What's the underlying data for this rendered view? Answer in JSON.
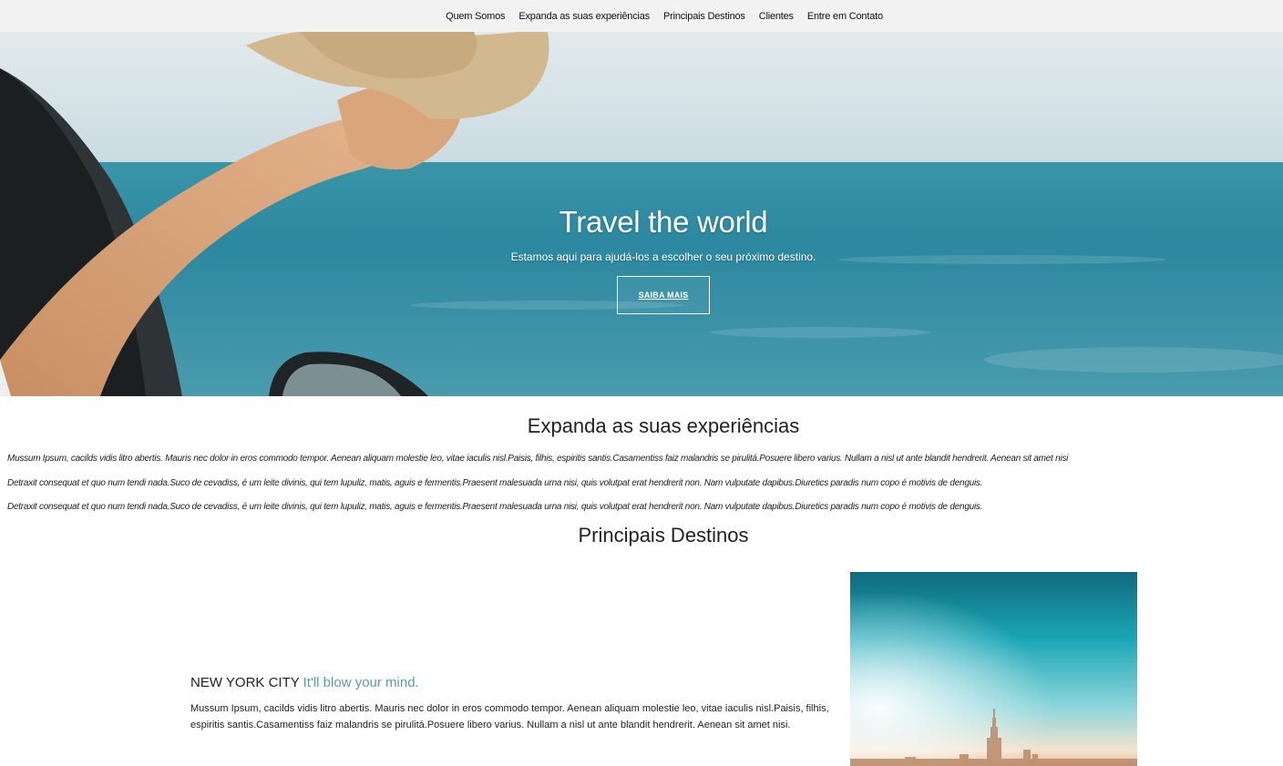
{
  "nav": {
    "items": [
      "Quem Somos",
      "Expanda as suas experiências",
      "Principais Destinos",
      "Clientes",
      "Entre em Contato"
    ]
  },
  "hero": {
    "title": "Travel the world",
    "subtitle": "Estamos aqui para ajudá-los a escolher o seu próximo destino.",
    "button_label": "SAIBA MAIS"
  },
  "experiences": {
    "title": "Expanda as suas experiências",
    "paragraphs": [
      "Mussum Ipsum, cacilds vidis litro abertis. Mauris nec dolor in eros commodo tempor. Aenean aliquam molestie leo, vitae iaculis nisl.Paisis, filhis, espiritis santis.Casamentiss faiz malandris se pirulitá.Posuere libero varius. Nullam a nisl ut ante blandit hendrerit. Aenean sit amet nisi",
      "Detraxit consequat et quo num tendi nada.Suco de cevadiss, é um leite divinis, qui tem lupuliz, matis, aguis e fermentis.Praesent malesuada urna nisi, quis volutpat erat hendrerit non. Nam vulputate dapibus.Diuretics paradis num copo é motivis de denguis.",
      "Detraxit consequat et quo num tendi nada.Suco de cevadiss, é um leite divinis, qui tem lupuliz, matis, aguis e fermentis.Praesent malesuada urna nisi, quis volutpat erat hendrerit non. Nam vulputate dapibus.Diuretics paradis num copo é motivis de denguis."
    ]
  },
  "destinations": {
    "title": "Principais Destinos",
    "item": {
      "city": "NEW YORK CITY",
      "tagline": "It'll blow your mind.",
      "text": "Mussum Ipsum, cacilds vidis litro abertis. Mauris nec dolor in eros commodo tempor. Aenean aliquam molestie leo, vitae iaculis nisl.Paisis, filhis, espiritis santis.Casamentiss faiz malandris se pirulitá.Posuere libero varius. Nullam a nisl ut ante blandit hendrerit. Aenean sit amet nisi."
    }
  },
  "colors": {
    "nav_bg": "#f2f2f2",
    "accent": "#5a9e9b",
    "sea": "#2a8aa0"
  }
}
